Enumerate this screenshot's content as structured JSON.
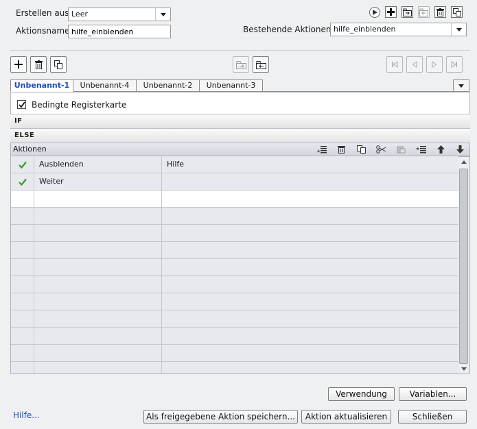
{
  "create_from": {
    "label": "Erstellen aus:",
    "value": "Leer"
  },
  "action_name": {
    "label": "Aktionsname:",
    "value": "hilfe_einblenden"
  },
  "existing_actions": {
    "label": "Bestehende Aktionen:",
    "value": "hilfe_einblenden"
  },
  "tabs": [
    {
      "label": "Unbenannt-1",
      "active": true
    },
    {
      "label": "Unbenannt-4"
    },
    {
      "label": "Unbenannt-2"
    },
    {
      "label": "Unbenannt-3"
    }
  ],
  "conditional_tab": {
    "label": "Bedingte Registerkarte",
    "checked": true
  },
  "if_label": "IF",
  "else_label": "ELSE",
  "actions_panel": {
    "title": "Aktionen"
  },
  "action_rows": [
    {
      "checked": true,
      "action": "Ausblenden",
      "target": "Hilfe"
    },
    {
      "checked": true,
      "action": "Weiter",
      "target": ""
    }
  ],
  "buttons": {
    "usage": "Verwendung",
    "variables": "Variablen...",
    "save_shared": "Als freigegebene Aktion speichern...",
    "update_action": "Aktion aktualisieren",
    "close": "Schließen"
  },
  "help_link": "Hilfe...",
  "colors": {
    "active_tab": "#1a47c4",
    "check": "#2f9e1f",
    "link": "#1d4bc2"
  }
}
